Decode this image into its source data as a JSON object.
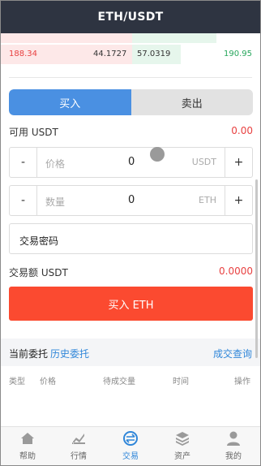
{
  "header": {
    "title": "ETH/USDT"
  },
  "orderbook": {
    "rows": [
      {
        "sell_price": "188.34",
        "sell_amount": "44.1727",
        "buy_amount": "57.0319",
        "buy_price": "190.95"
      }
    ]
  },
  "trade_toggle": {
    "buy_label": "买入",
    "sell_label": "卖出"
  },
  "available": {
    "label": "可用 USDT",
    "value": "0.00"
  },
  "price_input": {
    "minus": "-",
    "label": "价格",
    "value": "0",
    "unit": "USDT",
    "plus": "+"
  },
  "amount_input": {
    "minus": "-",
    "label": "数量",
    "value": "0",
    "unit": "ETH",
    "plus": "+"
  },
  "password": {
    "label": "交易密码"
  },
  "trade_total": {
    "label": "交易额 USDT",
    "value": "0.0000"
  },
  "submit": {
    "label": "买入 ETH"
  },
  "orders": {
    "current_tab": "当前委托",
    "history_tab": "历史委托",
    "query": "成交查询"
  },
  "order_columns": [
    "类型",
    "价格",
    "待成交量",
    "时间",
    "操作"
  ],
  "tabbar": {
    "items": [
      {
        "label": "帮助",
        "icon": "home-icon"
      },
      {
        "label": "行情",
        "icon": "chart-icon"
      },
      {
        "label": "交易",
        "icon": "trade-icon"
      },
      {
        "label": "资产",
        "icon": "layers-icon"
      },
      {
        "label": "我的",
        "icon": "user-icon"
      }
    ],
    "active": "交易"
  },
  "colors": {
    "header_bg": "#2e3441",
    "buy_blue": "#4a90e2",
    "sell_red": "#e84141",
    "up_green": "#26a65b",
    "button_red": "#fb4a30",
    "link_blue": "#2f86d9"
  }
}
